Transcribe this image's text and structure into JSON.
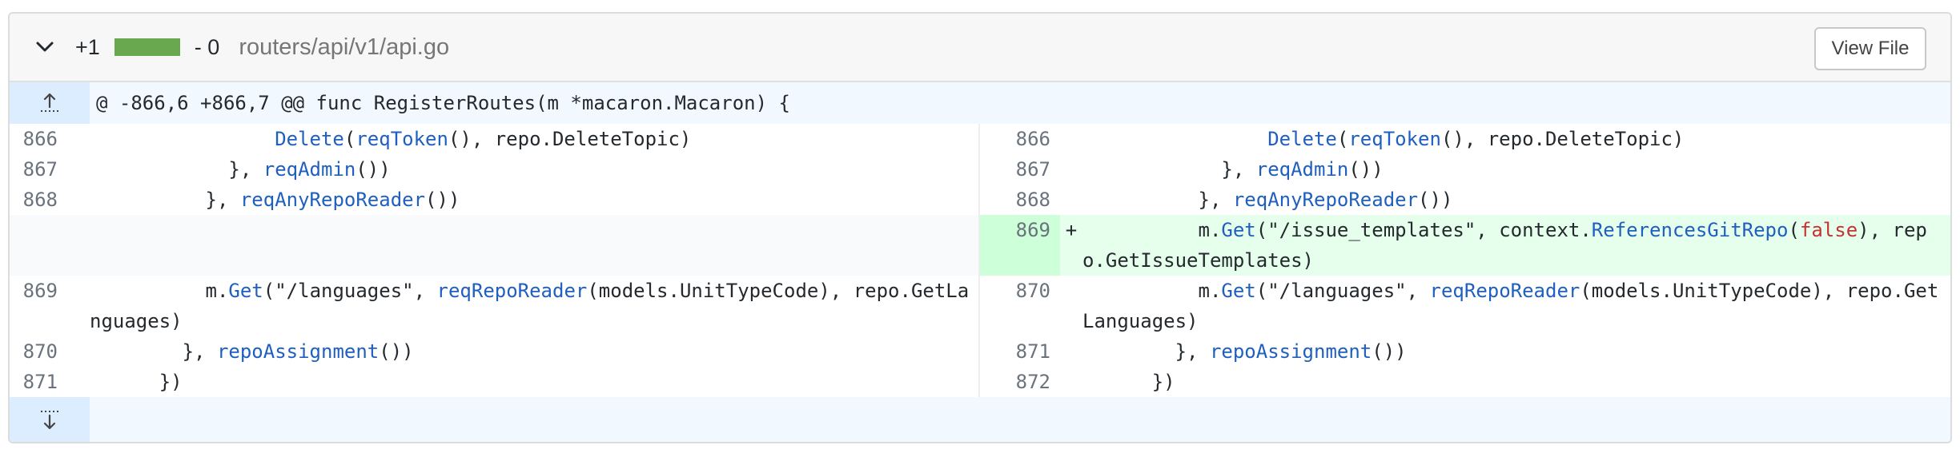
{
  "header": {
    "additions": "+1",
    "deletions": "- 0",
    "file_path": "routers/api/v1/api.go",
    "view_file_label": "View File",
    "add_color": "#6aa84f"
  },
  "hunk": {
    "text": "@ -866,6 +866,7 @@ func RegisterRoutes(m *macaron.Macaron) {"
  },
  "left": {
    "lines": [
      {
        "num": "866"
      },
      {
        "num": "867"
      },
      {
        "num": "868"
      },
      {
        "num": "869"
      },
      {
        "num": "870"
      },
      {
        "num": "871"
      }
    ]
  },
  "right": {
    "lines": [
      {
        "num": "866"
      },
      {
        "num": "867"
      },
      {
        "num": "868"
      },
      {
        "num": "869",
        "sign": "+"
      },
      {
        "num": "870"
      },
      {
        "num": "871"
      },
      {
        "num": "872"
      }
    ]
  },
  "code": {
    "l866_a": "                Delete(",
    "l866_fn_delete": "Delete",
    "l866_fn_reqtoken": "reqToken",
    "l866_rest": "(), repo.DeleteTopic)",
    "l867_pre": "            }, ",
    "l867_fn": "reqAdmin",
    "l867_rest": "())",
    "l868_pre": "          }, ",
    "l868_fn": "reqAnyRepoReader",
    "l868_rest": "())",
    "add_pre": "          m.",
    "add_get": "Get",
    "add_s1": "(\"/issue_templates\", context.",
    "add_fn": "ReferencesGitRepo",
    "add_false": "false",
    "add_s2": "), repo.GetIssueTemplates)",
    "lang_pre": "          m.",
    "lang_get": "Get",
    "lang_s1": "(\"/languages\", ",
    "lang_fn": "reqRepoReader",
    "lang_s2": "(models.UnitTypeCode), repo.GetLanguages)",
    "assign_pre": "        }, ",
    "assign_fn": "repoAssignment",
    "assign_rest": "())",
    "close": "      })",
    "del_indent": "                ",
    "paren_open": "(",
    "paren_close": ")"
  }
}
